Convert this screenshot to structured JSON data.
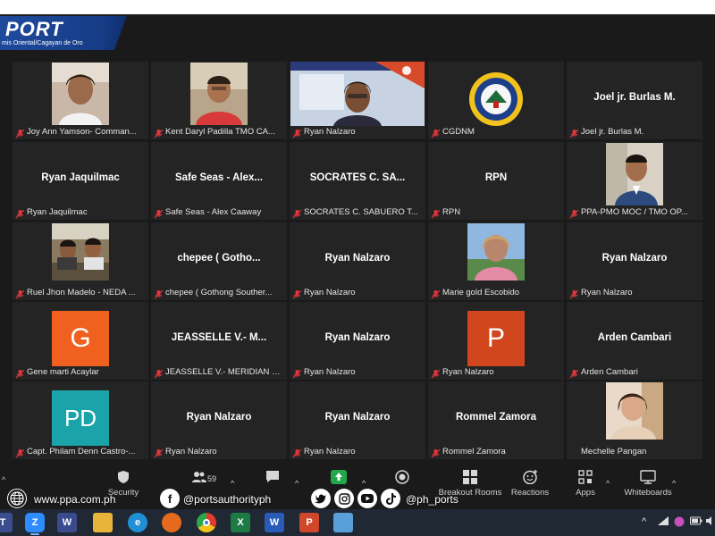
{
  "banner": {
    "title": "PORT",
    "subtitle": "mis Oriental/Cagayan de Oro"
  },
  "tiles": [
    {
      "label": "Joy Ann Yamson- Comman...",
      "center": "",
      "kind": "photo",
      "photo": "woman"
    },
    {
      "label": "Kent Daryl Padilla TMO CA...",
      "center": "",
      "kind": "photo",
      "photo": "man-red"
    },
    {
      "label": "Ryan Nalzaro",
      "center": "",
      "kind": "photo",
      "photo": "presenter"
    },
    {
      "label": "CGDNM",
      "center": "",
      "kind": "photo",
      "photo": "seal"
    },
    {
      "label": "Joel jr. Burlas M.",
      "center": "Joel jr. Burlas M.",
      "kind": "name"
    },
    {
      "label": "Ryan Jaquilmac",
      "center": "Ryan Jaquilmac",
      "kind": "name"
    },
    {
      "label": "Safe Seas - Alex Caaway",
      "center": "Safe Seas - Alex...",
      "kind": "name"
    },
    {
      "label": "SOCRATES C. SABUERO T...",
      "center": "SOCRATES C. SA...",
      "kind": "name"
    },
    {
      "label": "RPN",
      "center": "RPN",
      "kind": "name"
    },
    {
      "label": "PPA-PMO MOC / TMO OP...",
      "center": "",
      "kind": "photo",
      "photo": "man-office"
    },
    {
      "label": "Ruel Jhon Madelo - NEDA ...",
      "center": "",
      "kind": "photo",
      "photo": "group"
    },
    {
      "label": "chepee ( Gothong Souther...",
      "center": "chepee ( Gotho...",
      "kind": "name"
    },
    {
      "label": "Ryan Nalzaro",
      "center": "Ryan Nalzaro",
      "kind": "name"
    },
    {
      "label": "Marie gold Escobido",
      "center": "",
      "kind": "photo",
      "photo": "woman-outdoor"
    },
    {
      "label": "Ryan Nalzaro",
      "center": "Ryan Nalzaro",
      "kind": "name"
    },
    {
      "label": "Gene marti Acaylar",
      "center": "",
      "kind": "avatar",
      "letter": "G",
      "color": "#f0601f"
    },
    {
      "label": "JEASSELLE V.- MERIDIAN C...",
      "center": "JEASSELLE V.- M...",
      "kind": "name"
    },
    {
      "label": "Ryan Nalzaro",
      "center": "Ryan Nalzaro",
      "kind": "name"
    },
    {
      "label": "Ryan Nalzaro",
      "center": "",
      "kind": "avatar",
      "letter": "P",
      "color": "#d2461e"
    },
    {
      "label": "Arden Cambari",
      "center": "Arden Cambari",
      "kind": "name"
    },
    {
      "label": "Capt. Philam Denn Castro-...",
      "center": "",
      "kind": "avatar",
      "letter": "PD",
      "color": "#1aa3a8"
    },
    {
      "label": "Ryan Nalzaro",
      "center": "Ryan Nalzaro",
      "kind": "name"
    },
    {
      "label": "Ryan Nalzaro",
      "center": "Ryan Nalzaro",
      "kind": "name"
    },
    {
      "label": "Rommel Zamora",
      "center": "Rommel Zamora",
      "kind": "name"
    },
    {
      "label": "Mechelle Pangan",
      "center": "",
      "kind": "photo",
      "photo": "woman-2",
      "unmuted": true
    }
  ],
  "toolbar": {
    "security": "Security",
    "participants_count": "59",
    "breakout": "Breakout Rooms",
    "reactions": "Reactions",
    "apps": "Apps",
    "whiteboards": "Whiteboards"
  },
  "social": {
    "website": "www.ppa.com.ph",
    "facebook": "@portsauthorityph",
    "handle": "@ph_ports"
  },
  "colors": {
    "tile_bg": "#242424",
    "screen_bg": "#1a1a1a",
    "banner": "#1f4a9c",
    "muted_mic": "#e0363c"
  }
}
